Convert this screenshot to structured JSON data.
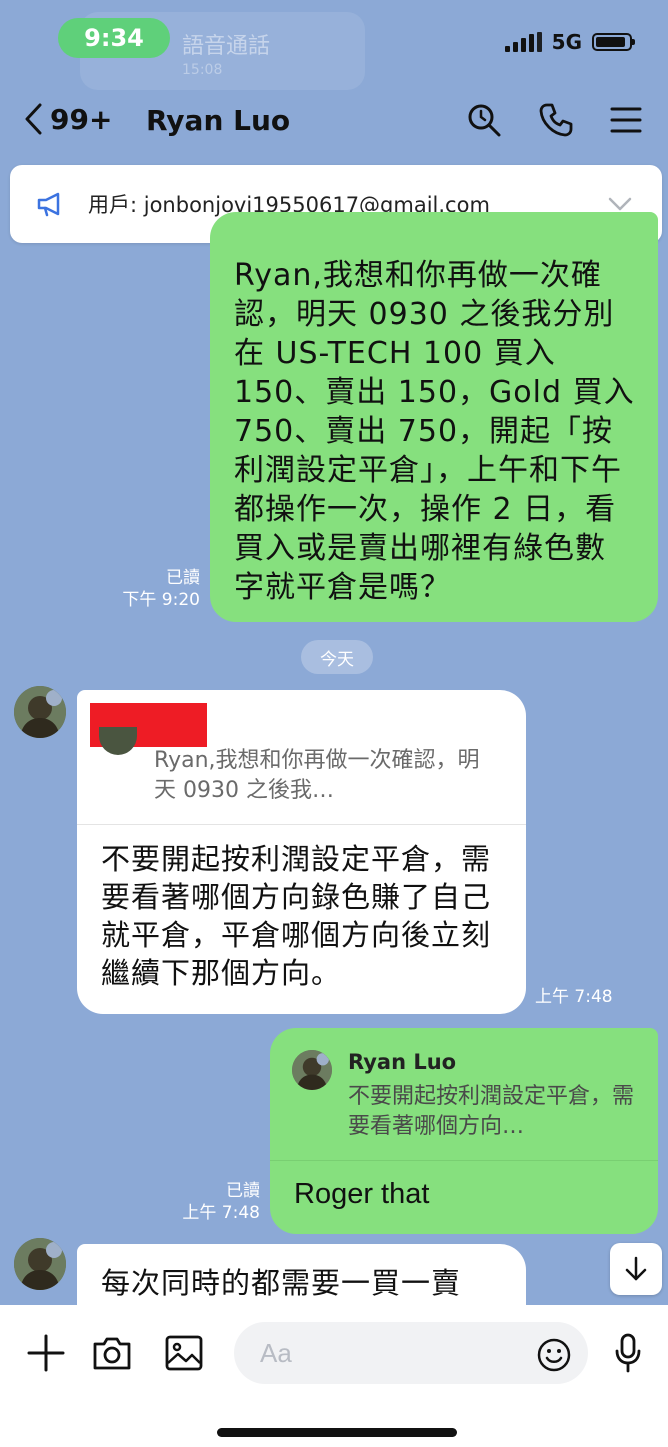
{
  "status_bar": {
    "time": "9:34",
    "network": "5G"
  },
  "background_call": {
    "title": "語音通話",
    "sub": "15:08"
  },
  "header": {
    "back_count": "99+",
    "title": "Ryan Luo"
  },
  "announcement": {
    "text": "用戶: jonbonjovi19550617@gmail.com"
  },
  "messages": {
    "m1": {
      "text": "Ryan,我想和你再做一次確認，明天 0930 之後我分別在 US-TECH 100 買入 150、賣出 150，Gold 買入 750、賣出 750，開起「按利潤設定平倉」，上午和下午都操作一次，操作 2 日，看買入或是賣出哪裡有綠色數字就平倉是嗎？",
      "read": "已讀",
      "time": "下午 9:20"
    },
    "date_divider": "今天",
    "m2": {
      "quote_text": "Ryan,我想和你再做一次確認，明天 0930 之後我…",
      "text": "不要開起按利潤設定平倉，需要看著哪個方向錄色賺了自己就平倉，平倉哪個方向後立刻繼續下那個方向。",
      "time": "上午 7:48"
    },
    "m3": {
      "quote_name": "Ryan Luo",
      "quote_text": "不要開起按利潤設定平倉，需要看著哪個方向…",
      "text": "Roger that",
      "read": "已讀",
      "time": "上午 7:48"
    },
    "m4": {
      "text": "每次同時的都需要一買一賣"
    }
  },
  "composer": {
    "placeholder": "Aa"
  },
  "colors": {
    "background": "#8ca9d6",
    "outgoing": "#86e07e",
    "incoming": "#ffffff",
    "time_pill": "#5fd07a",
    "redaction": "#ee1c25"
  }
}
